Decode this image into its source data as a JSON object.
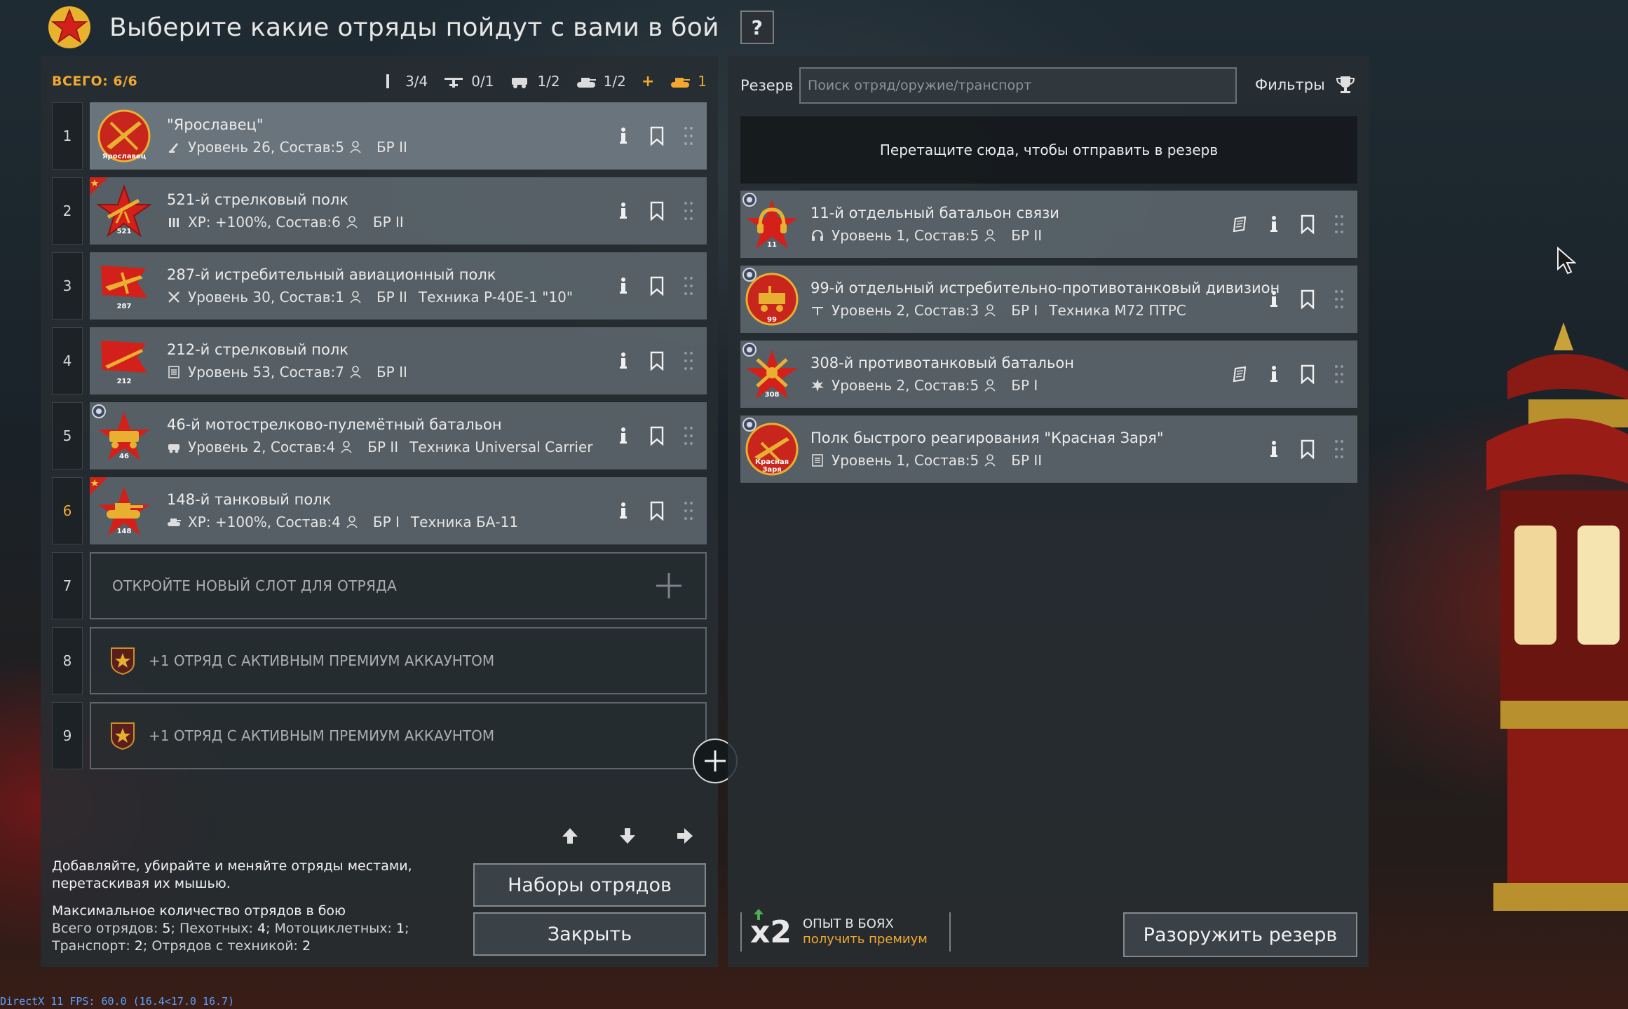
{
  "header": {
    "title": "Выберите какие отряды пойдут с вами в бой",
    "help_label": "?"
  },
  "left": {
    "total": "ВСЕГО: 6/6",
    "stats": [
      {
        "icon": "infantry-icon",
        "value": "3/4"
      },
      {
        "icon": "aircraft-icon",
        "value": "0/1"
      },
      {
        "icon": "vehicle-icon",
        "value": "1/2"
      },
      {
        "icon": "tank-icon",
        "value": "1/2"
      }
    ],
    "stat_plus": "+",
    "stat_extra": "1",
    "squads": [
      {
        "num": "1",
        "name": "\"Ярославец\"",
        "meta": "Уровень 26, Состав:5",
        "br": "БР II",
        "tech": "",
        "emblem_label": "Ярославец"
      },
      {
        "num": "2",
        "name": "521-й стрелковый полк",
        "meta": "XP: +100%, Состав:6",
        "br": "БР II",
        "tech": "",
        "emblem_label": "521"
      },
      {
        "num": "3",
        "name": "287-й истребительный авиационный полк",
        "meta": "Уровень 30, Состав:1",
        "br": "БР II",
        "tech": "Техника P-40E-1 \"10\"",
        "emblem_label": "287"
      },
      {
        "num": "4",
        "name": "212-й стрелковый полк",
        "meta": "Уровень 53, Состав:7",
        "br": "БР II",
        "tech": "",
        "emblem_label": "212"
      },
      {
        "num": "5",
        "name": "46-й мотострелково-пулемётный батальон",
        "meta": "Уровень 2, Состав:4",
        "br": "БР II",
        "tech": "Техника Universal Carrier",
        "emblem_label": "46"
      },
      {
        "num": "6",
        "name": "148-й танковый полк",
        "meta": "XP: +100%, Состав:4",
        "br": "БР I",
        "tech": "Техника БА-11",
        "emblem_label": "148"
      }
    ],
    "empty_slot": {
      "num": "7",
      "label": "ОТКРОЙТЕ НОВЫЙ СЛОТ ДЛЯ ОТРЯДА"
    },
    "premium_slots": [
      {
        "num": "8",
        "label": "+1 ОТРЯД С АКТИВНЫМ ПРЕМИУМ АККАУНТОМ"
      },
      {
        "num": "9",
        "label": "+1 ОТРЯД С АКТИВНЫМ ПРЕМИУМ АККАУНТОМ"
      }
    ],
    "hint": "Добавляйте, убирайте и меняйте отряды местами, перетаскивая их мышью.",
    "limits": {
      "heading": "Максимальное количество отрядов в бою",
      "l1a": "Всего отрядов: ",
      "v1a": "5",
      "l1b": "; Пехотных: ",
      "v1b": "4",
      "l1c": "; Мотоциклетных: ",
      "v1c": "1",
      "l1d": ";",
      "l2a": "Транспорт: ",
      "v2a": "2",
      "l2b": "; Отрядов с техникой: ",
      "v2b": "2"
    },
    "btn_sets": "Наборы отрядов",
    "btn_close": "Закрыть"
  },
  "right": {
    "reserve_label": "Резерв",
    "search_placeholder": "Поиск отряд/оружие/транспорт",
    "filters_label": "Фильтры",
    "dropzone": "Перетащите сюда, чтобы отправить в резерв",
    "squads": [
      {
        "name": "11-й отдельный батальон связи",
        "meta": "Уровень 1, Состав:5",
        "br": "БР II",
        "tech": "",
        "emblem_label": "11",
        "book": true
      },
      {
        "name": "99-й отдельный истребительно-противотанковый дивизион",
        "meta": "Уровень 2, Состав:3",
        "br": "БР I",
        "tech": "Техника M72 ПТРС",
        "emblem_label": "99",
        "book": false
      },
      {
        "name": "308-й противотанковый батальон",
        "meta": "Уровень 2, Состав:5",
        "br": "БР I",
        "tech": "",
        "emblem_label": "308",
        "book": true
      },
      {
        "name": "Полк быстрого реагирования \"Красная Заря\"",
        "meta": "Уровень 1, Состав:5",
        "br": "БР II",
        "tech": "",
        "emblem_label": "Красная Заря",
        "book": false
      }
    ],
    "exp_multiplier": "x2",
    "exp_title": "ОПЫТ В БОЯХ",
    "exp_link": "получить премиум",
    "btn_disarm": "Разоружить резерв"
  },
  "fps": "DirectX 11 FPS: 60.0 (16.4<17.0 16.7)",
  "colors": {
    "accent": "#f0a830",
    "panel": "#262d32",
    "emblem_red": "#c8261c",
    "emblem_gold": "#e8b030"
  }
}
